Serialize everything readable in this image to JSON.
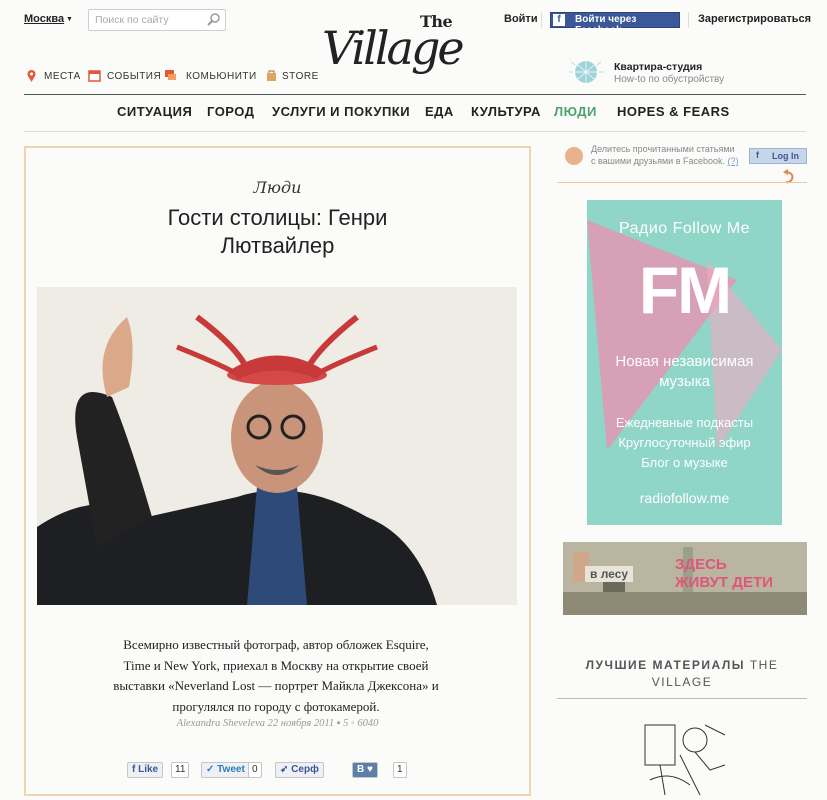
{
  "header": {
    "city": "Москва",
    "search_placeholder": "Поиск по сайту",
    "logo_the": "The",
    "logo_village": "Village",
    "login": "Войти",
    "fb_login": "Войти через Facebook",
    "register": "Зарегистрироваться",
    "subnav": [
      {
        "label": "МЕСТА",
        "icon": "map-pin-icon"
      },
      {
        "label": "СОБЫТИЯ",
        "icon": "calendar-icon"
      },
      {
        "label": "КОМЬЮНИТИ",
        "icon": "chat-icon"
      },
      {
        "label": "STORE",
        "icon": "bag-icon"
      }
    ],
    "promo": {
      "title": "Квартира-студия",
      "subtitle": "How-to по обустройству"
    }
  },
  "nav": [
    "СИТУАЦИЯ",
    "ГОРОД",
    "УСЛУГИ И ПОКУПКИ",
    "ЕДА",
    "КУЛЬТУРА",
    "ЛЮДИ",
    "HOPES & FEARS"
  ],
  "colors": {
    "active_nav": "#4aa36b",
    "accent_border": "#f0d6b0",
    "facebook": "#3b5998"
  },
  "article": {
    "rubric": "Люди",
    "title_line1": "Гости столицы: Генри",
    "title_line2": "Лютвайлер",
    "lead_line1": "Всемирно известный фотограф, автор обложек Esquire,",
    "lead_line2": "Time и New York, приехал в Москву на открытие своей",
    "lead_line3": "выставки «Neverland Lost — портрет Майкла Джексона» и",
    "lead_line4": "прогулялся по городу с фотокамерой.",
    "author": "Alexandra Sheveleva",
    "date": "22 ноября 2011",
    "comments": "5",
    "views": "6040",
    "social": {
      "like": "Like",
      "like_count": "11",
      "tweet": "Tweet",
      "tweet_count": "0",
      "surf": "Серф",
      "vk": "В",
      "vk_count": "1"
    }
  },
  "sidebar": {
    "share_text1": "Делитесь прочитанными статьями",
    "share_text2": "с вашими друзьями в Facebook.",
    "share_help": "(?)",
    "fb_log_in": "Log In",
    "ad1": {
      "title": "Радио Follow Me",
      "logo": "FM",
      "line1": "Новая независимая",
      "line2": "музыка",
      "line3": "Ежедневные подкасты",
      "line4": "Круглосуточный эфир",
      "line5": "Блог о музыке",
      "url": "radiofollow.me"
    },
    "ad2": {
      "brand": "в лесу",
      "line1": "ЗДЕСЬ",
      "line2": "ЖИВУТ ДЕТИ"
    },
    "best_title_bold": "ЛУЧШИЕ МАТЕРИАЛЫ",
    "best_title_rest": "THE",
    "best_title_line2": "VILLAGE"
  }
}
